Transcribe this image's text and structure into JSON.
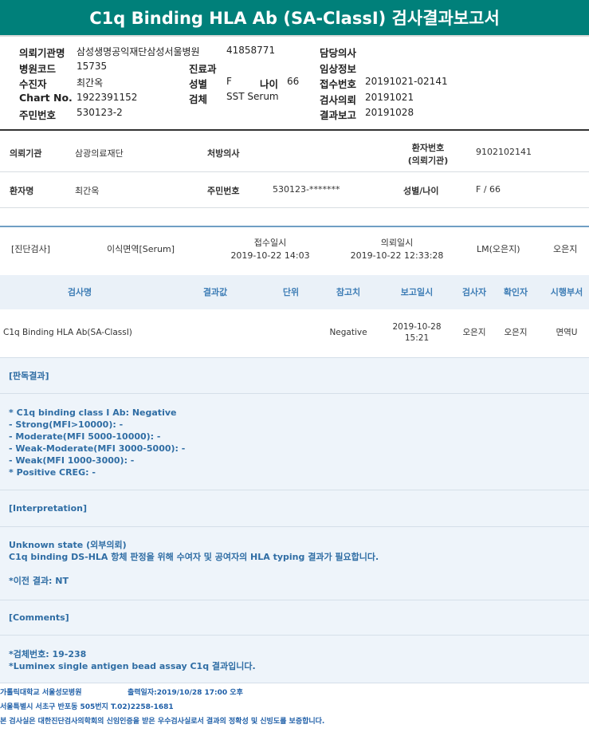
{
  "title": "C1q Binding HLA Ab (SA-ClassI) 검사결과보고서",
  "report_header": {
    "rows": [
      [
        {
          "label": "의뢰기관명",
          "value": "삼성생명공익재단삼성서울병원"
        },
        {
          "label": "",
          "value": "41858771"
        },
        {
          "label": "담당의사",
          "value": ""
        }
      ],
      [
        {
          "label": "병원코드",
          "value": "15735"
        },
        {
          "label": "진료과",
          "value": ""
        },
        {
          "label": "임상정보",
          "value": ""
        }
      ],
      [
        {
          "label": "수진자",
          "value": "최간옥"
        },
        {
          "label": "성별",
          "value": "F"
        },
        {
          "label": "나이",
          "value": "66"
        },
        {
          "label": "접수번호",
          "value": "20191021-02141"
        }
      ],
      [
        {
          "label": "Chart No.",
          "value": "1922391152"
        },
        {
          "label": "검체",
          "value": "SST Serum"
        },
        {
          "label": "검사의뢰",
          "value": "20191021"
        }
      ],
      [
        {
          "label": "주민번호",
          "value": "530123-2"
        },
        {
          "label": "결과보고",
          "value": "20191028"
        }
      ]
    ]
  },
  "patient_info": {
    "institution_label": "의뢰기관",
    "institution_value": "삼광의료재단",
    "doctor_label": "처방의사",
    "doctor_value": "",
    "patient_no_label_1": "환자번호",
    "patient_no_label_2": "(의뢰기관)",
    "patient_no_value": "9102102141",
    "name_label": "환자명",
    "name_value": "최간옥",
    "ssn_label": "주민번호",
    "ssn_value": "530123-*******",
    "sex_age_label": "성별/나이",
    "sex_age_value": "F / 66"
  },
  "test_info": {
    "category": "[진단검사]",
    "specimen": "이식면역[Serum]",
    "received_label": "접수일시",
    "received_value": "2019-10-22 14:03",
    "requested_label": "의뢰일시",
    "requested_value": "2019-10-22 12:33:28",
    "lm": "LM(오은지)",
    "person": "오은지"
  },
  "table": {
    "headers": [
      "검사명",
      "결과값",
      "단위",
      "참고치",
      "보고일시",
      "검사자",
      "확인자",
      "시행부서"
    ],
    "rows": [
      {
        "name": "C1q Binding HLA Ab(SA-ClassI)",
        "result": "",
        "unit": "",
        "reference": "Negative",
        "report_date": "2019-10-28",
        "report_time": "15:21",
        "tester": "오은지",
        "checker": "오은지",
        "dept": "면역U"
      }
    ]
  },
  "sections": {
    "judgment_title": "[판독결과]",
    "judgment_lines": [
      "* C1q binding class I Ab: Negative",
      "- Strong(MFI>10000): -",
      "- Moderate(MFI 5000-10000): -",
      "- Weak-Moderate(MFI 3000-5000): -",
      "- Weak(MFI 1000-3000): -",
      "* Positive CREG: -"
    ],
    "interpretation_title": "[Interpretation]",
    "interpretation_lines": [
      "Unknown state (외부의뢰)",
      "C1q binding DS-HLA 항체 판정을 위해 수여자 및 공여자의 HLA typing 결과가 필요합니다."
    ],
    "previous_result": "*이전 결과: NT",
    "comments_title": "[Comments]",
    "comments_lines": [
      "*검체번호: 19-238",
      "*Luminex single antigen bead assay C1q 결과입니다."
    ]
  },
  "footer": {
    "hospital": "가톨릭대학교 서울성모병원",
    "printed": "출력일자:2019/10/28 17:00 오후",
    "address": "서울특별시 서초구 반포동 505번지 T.02)2258-1681",
    "certification": "본 검사실은 대한진단검사의학회의 신임인증을 받은 우수검사실로서 결과의 정확성 및 신빙도를 보증합니다."
  }
}
